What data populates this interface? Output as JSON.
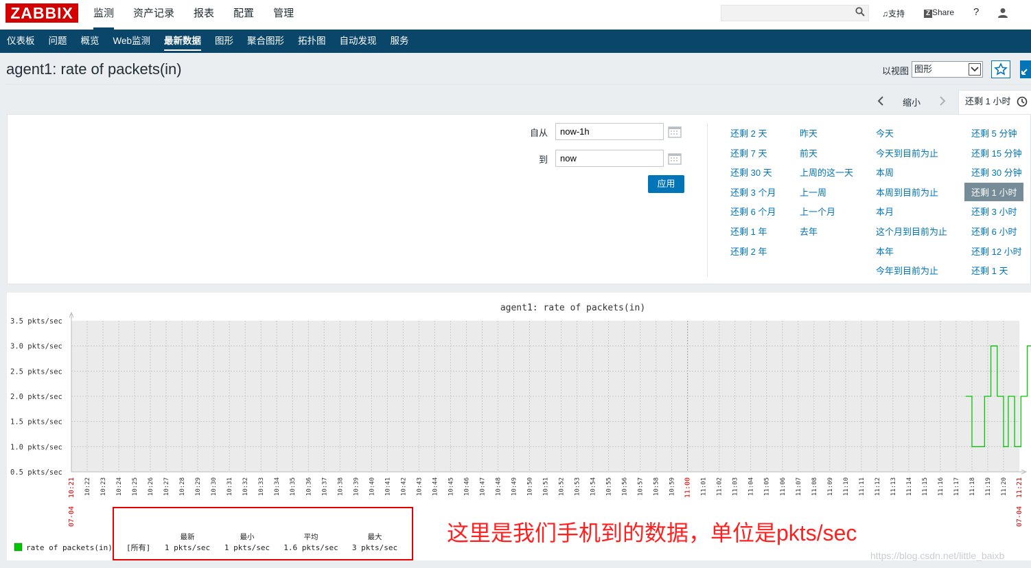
{
  "header": {
    "logo": "ZABBIX",
    "top_menu": [
      "监测",
      "资产记录",
      "报表",
      "配置",
      "管理"
    ],
    "support": "支持",
    "share": "Share",
    "help": "?",
    "search": {
      "value": "",
      "placeholder": ""
    }
  },
  "sub_nav": [
    "仪表板",
    "问题",
    "概览",
    "Web监测",
    "最新数据",
    "图形",
    "聚合图形",
    "拓扑图",
    "自动发现",
    "服务"
  ],
  "page": {
    "title": "agent1: rate of packets(in)",
    "view_as_label": "以视图",
    "view_as_value": "图形"
  },
  "time": {
    "zoom_out": "缩小",
    "range_tab": "还剩 1 小时",
    "from_label": "自从",
    "from_value": "now-1h",
    "to_label": "到",
    "to_value": "now",
    "apply": "应用",
    "quick": [
      [
        "还剩 2 天",
        "还剩 7 天",
        "还剩 30 天",
        "还剩 3 个月",
        "还剩 6 个月",
        "还剩 1 年",
        "还剩 2 年"
      ],
      [
        "昨天",
        "前天",
        "上周的这一天",
        "上一周",
        "上一个月",
        "去年"
      ],
      [
        "今天",
        "今天到目前为止",
        "本周",
        "本周到目前为止",
        "本月",
        "这个月到目前为止",
        "本年",
        "今年到目前为止"
      ],
      [
        "还剩 5 分钟",
        "还剩 15 分钟",
        "还剩 30 分钟",
        "还剩 1 小时",
        "还剩 3 小时",
        "还剩 6 小时",
        "还剩 12 小时",
        "还剩 1 天"
      ]
    ],
    "selected": "还剩 1 小时"
  },
  "chart_data": {
    "type": "line",
    "title": "agent1: rate of packets(in)",
    "y_ticks": [
      "3.5 pkts/sec",
      "3.0 pkts/sec",
      "2.5 pkts/sec",
      "2.0 pkts/sec",
      "1.5 pkts/sec",
      "1.0 pkts/sec",
      "0.5 pkts/sec"
    ],
    "ylim": [
      0.5,
      3.5
    ],
    "x_start_date": "07-04",
    "x_start_time": "10:21",
    "x_end_date": "07-04",
    "x_end_time": "11:21",
    "x_major_label": "11:00",
    "x_ticks": [
      "10:22",
      "10:23",
      "10:24",
      "10:25",
      "10:26",
      "10:27",
      "10:28",
      "10:29",
      "10:30",
      "10:31",
      "10:32",
      "10:33",
      "10:34",
      "10:35",
      "10:36",
      "10:37",
      "10:38",
      "10:39",
      "10:40",
      "10:41",
      "10:42",
      "10:43",
      "10:44",
      "10:45",
      "10:46",
      "10:47",
      "10:48",
      "10:49",
      "10:50",
      "10:51",
      "10:52",
      "10:53",
      "10:54",
      "10:55",
      "10:56",
      "10:57",
      "10:58",
      "10:59",
      "11:01",
      "11:02",
      "11:03",
      "11:04",
      "11:05",
      "11:06",
      "11:07",
      "11:08",
      "11:09",
      "11:10",
      "11:11",
      "11:12",
      "11:13",
      "11:14",
      "11:15",
      "11:16",
      "11:17",
      "11:18",
      "11:19",
      "11:20"
    ],
    "series": [
      {
        "name": "rate of packets(in)",
        "color": "#00c800",
        "points": [
          [
            56.6,
            2
          ],
          [
            57.0,
            1
          ],
          [
            57.8,
            2
          ],
          [
            58.2,
            3
          ],
          [
            58.6,
            2
          ],
          [
            59.0,
            1
          ],
          [
            59.3,
            2
          ],
          [
            59.7,
            1
          ],
          [
            60.1,
            2
          ],
          [
            60.5,
            3
          ],
          [
            60.8,
            2
          ],
          [
            61.2,
            1
          ],
          [
            61.5,
            2
          ],
          [
            62.1,
            3
          ],
          [
            62.4,
            2
          ],
          [
            62.6,
            1
          ]
        ]
      }
    ],
    "legend": {
      "color": "#00c800",
      "name": "rate of packets(in)",
      "all": "[所有]",
      "headers": [
        "最新",
        "最小",
        "平均",
        "最大"
      ],
      "values": [
        "1 pkts/sec",
        "1 pkts/sec",
        "1.6 pkts/sec",
        "3 pkts/sec"
      ]
    }
  },
  "annotation": "这里是我们手机到的数据，单位是pkts/sec",
  "watermark": "https://blog.csdn.net/little_baixb"
}
